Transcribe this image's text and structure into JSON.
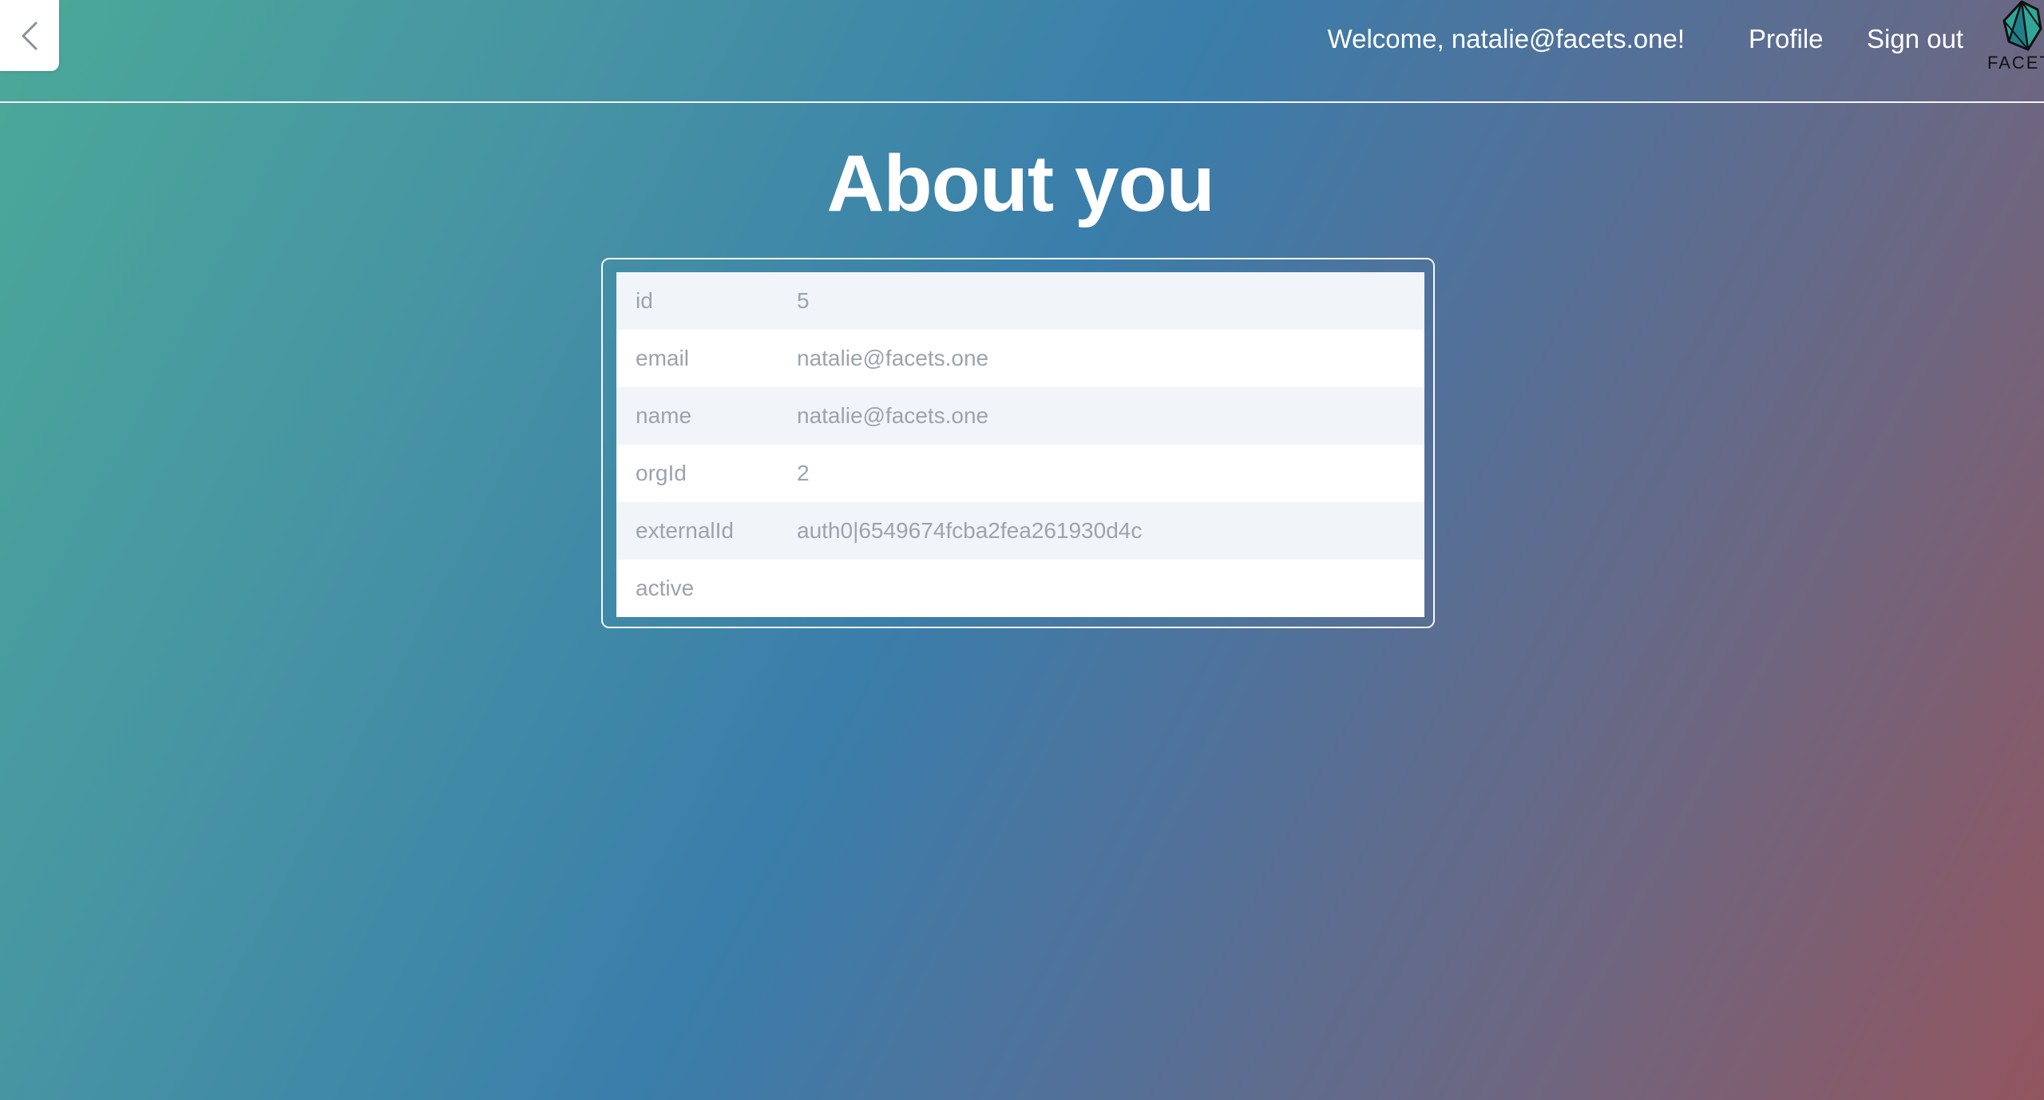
{
  "header": {
    "welcome": "Welcome, natalie@facets.one!",
    "profile_label": "Profile",
    "signout_label": "Sign out",
    "logo_text": "FACETS",
    "back_icon": "chevron-left-icon",
    "logo_icon": "facets-crystal-logo"
  },
  "main": {
    "title": "About you",
    "rows": [
      {
        "key": "id",
        "value": "5"
      },
      {
        "key": "email",
        "value": "natalie@facets.one"
      },
      {
        "key": "name",
        "value": "natalie@facets.one"
      },
      {
        "key": "orgId",
        "value": "2"
      },
      {
        "key": "externalId",
        "value": "auth0|6549674fcba2fea261930d4c"
      },
      {
        "key": "active",
        "value": ""
      }
    ]
  },
  "colors": {
    "gradient_start": "#4aa998",
    "gradient_mid": "#3a7eab",
    "gradient_end": "#92555f",
    "row_alt": "#f1f5f9",
    "row_text": "#9ca3af"
  }
}
